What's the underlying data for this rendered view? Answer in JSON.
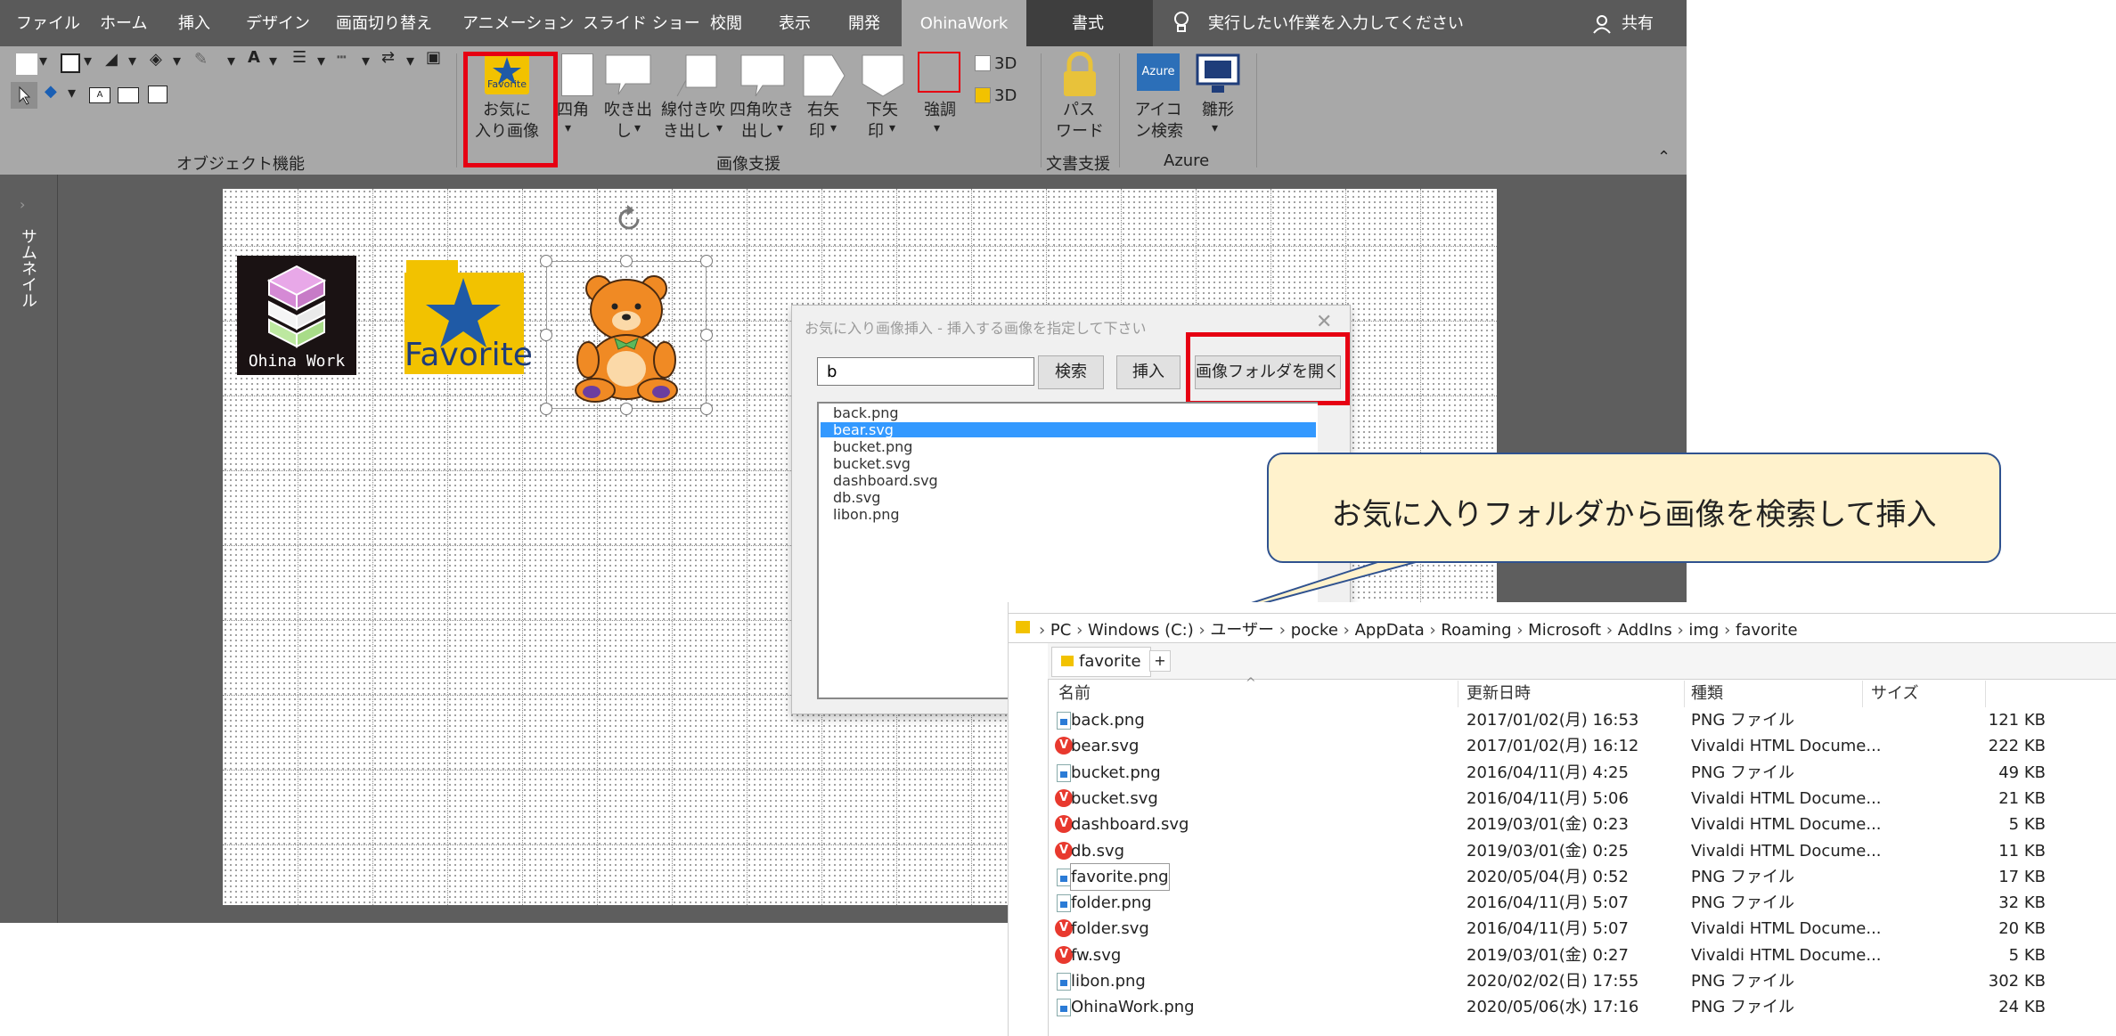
{
  "menubar": {
    "tabs": [
      "ファイル",
      "ホーム",
      "挿入",
      "デザイン",
      "画面切り替え",
      "アニメーション",
      "スライド ショー",
      "校閲",
      "表示",
      "開発",
      "OhinaWork",
      "書式"
    ],
    "tellme": "実行したい作業を入力してください",
    "share": "共有"
  },
  "ribbon": {
    "groups": {
      "object": "オブジェクト機能",
      "image_support": "画像支援",
      "doc_support": "文書支援",
      "azure": "Azure"
    },
    "favorite_icon_text": "Favorite",
    "azure_icon_text": "Azure",
    "buttons": {
      "favorite": [
        "お気に",
        "入り画像"
      ],
      "rect": [
        "四角"
      ],
      "fukidashi": [
        "吹き出",
        "し"
      ],
      "line_fukidashi": [
        "線付き吹",
        "き出し"
      ],
      "rect_fukidashi": [
        "四角吹き",
        "出し"
      ],
      "right_arrow": [
        "右矢",
        "印"
      ],
      "down_arrow": [
        "下矢",
        "印"
      ],
      "emphasis": [
        "強調"
      ],
      "threed_1": "3D",
      "threed_2": "3D",
      "password": [
        "パス",
        "ワード"
      ],
      "icon_search": [
        "アイコ",
        "ン検索"
      ],
      "hinagata": [
        "雛形"
      ]
    }
  },
  "thumbnail_label": "サムネイル",
  "slide": {
    "logo_text": "Ohina Work",
    "favorite_text": "Favorite"
  },
  "dialog": {
    "title": "お気に入り画像挿入 - 挿入する画像を指定して下さい",
    "search_value": "b",
    "buttons": {
      "search": "検索",
      "insert": "挿入",
      "open_folder": "画像フォルダを開く"
    },
    "items": [
      "back.png",
      "bear.svg",
      "bucket.png",
      "bucket.svg",
      "dashboard.svg",
      "db.svg",
      "libon.png"
    ],
    "selected_index": 1
  },
  "callout": {
    "text": "お気に入りフォルダから画像を検索して挿入"
  },
  "explorer": {
    "breadcrumb": [
      "PC",
      "Windows (C:)",
      "ユーザー",
      "pocke",
      "AppData",
      "Roaming",
      "Microsoft",
      "AddIns",
      "img",
      "favorite"
    ],
    "tab": "favorite",
    "columns": {
      "name": "名前",
      "date": "更新日時",
      "type": "種類",
      "size": "サイズ"
    },
    "files": [
      {
        "name": "back.png",
        "date": "2017/01/02(月) 16:53",
        "type": "PNG ファイル",
        "size": "121 KB",
        "kind": "png"
      },
      {
        "name": "bear.svg",
        "date": "2017/01/02(月) 16:12",
        "type": "Vivaldi HTML Docume...",
        "size": "222 KB",
        "kind": "svg"
      },
      {
        "name": "bucket.png",
        "date": "2016/04/11(月) 4:25",
        "type": "PNG ファイル",
        "size": "49 KB",
        "kind": "png"
      },
      {
        "name": "bucket.svg",
        "date": "2016/04/11(月) 5:06",
        "type": "Vivaldi HTML Docume...",
        "size": "21 KB",
        "kind": "svg"
      },
      {
        "name": "dashboard.svg",
        "date": "2019/03/01(金) 0:23",
        "type": "Vivaldi HTML Docume...",
        "size": "5 KB",
        "kind": "svg"
      },
      {
        "name": "db.svg",
        "date": "2019/03/01(金) 0:25",
        "type": "Vivaldi HTML Docume...",
        "size": "11 KB",
        "kind": "svg"
      },
      {
        "name": "favorite.png",
        "date": "2020/05/04(月) 0:52",
        "type": "PNG ファイル",
        "size": "17 KB",
        "kind": "png"
      },
      {
        "name": "folder.png",
        "date": "2016/04/11(月) 5:07",
        "type": "PNG ファイル",
        "size": "32 KB",
        "kind": "png"
      },
      {
        "name": "folder.svg",
        "date": "2016/04/11(月) 5:07",
        "type": "Vivaldi HTML Docume...",
        "size": "20 KB",
        "kind": "svg"
      },
      {
        "name": "fw.svg",
        "date": "2019/03/01(金) 0:27",
        "type": "Vivaldi HTML Docume...",
        "size": "5 KB",
        "kind": "svg"
      },
      {
        "name": "libon.png",
        "date": "2020/02/02(日) 17:55",
        "type": "PNG ファイル",
        "size": "302 KB",
        "kind": "png"
      },
      {
        "name": "OhinaWork.png",
        "date": "2020/05/06(水) 17:16",
        "type": "PNG ファイル",
        "size": "24 KB",
        "kind": "png"
      }
    ]
  },
  "colors": {
    "highlight_red": "#e60012",
    "callout_fill": "#fff2cc",
    "callout_border": "#2f528f",
    "selection_blue": "#3399ff"
  }
}
